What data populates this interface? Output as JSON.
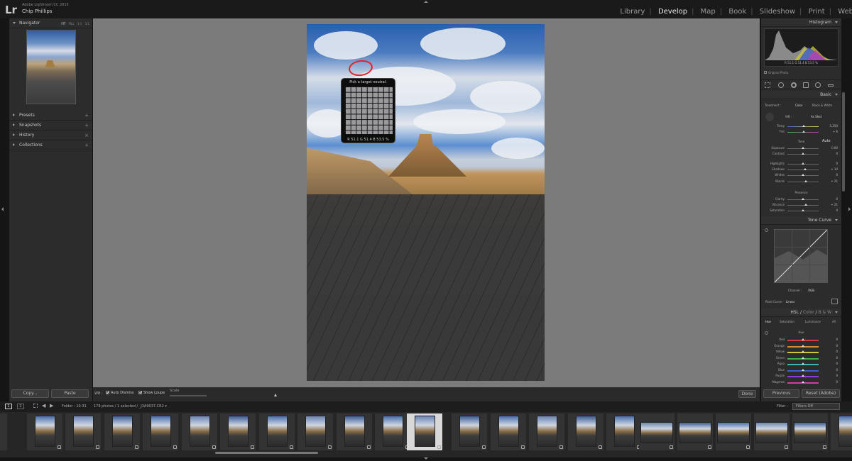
{
  "app": {
    "product": "Adobe Lightroom CC 2015",
    "user": "Chip Phillips",
    "logo": "Lr"
  },
  "modules": {
    "items": [
      "Library",
      "Develop",
      "Map",
      "Book",
      "Slideshow",
      "Print",
      "Web"
    ],
    "active": "Develop"
  },
  "left_panel": {
    "navigator": {
      "title": "Navigator",
      "options": [
        "FIT",
        "FILL",
        "1:1",
        "3:1"
      ]
    },
    "sections": [
      {
        "title": "Presets",
        "action": "+"
      },
      {
        "title": "Snapshots",
        "action": "+"
      },
      {
        "title": "History",
        "action": "×"
      },
      {
        "title": "Collections",
        "action": "+"
      }
    ],
    "copy_label": "Copy...",
    "paste_label": "Paste"
  },
  "loupe": {
    "title": "Pick a target neutral:",
    "readout": "R  51.1  G  51.4  B  53.5  %"
  },
  "toolbar": {
    "wb_label": "WB :",
    "auto_dismiss": "Auto Dismiss",
    "show_loupe": "Show Loupe",
    "scale_label": "Scale",
    "scale_level": 0.35,
    "done_label": "Done"
  },
  "right_panel": {
    "histogram": {
      "title": "Histogram",
      "readout": "R  51.1  G  51.4  B  53.5  %",
      "original_photo": "Original Photo"
    },
    "basic": {
      "title": "Basic",
      "treatment_label": "Treatment :",
      "treatment_color": "Color",
      "treatment_bw": "Black & White",
      "wb_label": "WB :",
      "wb_value": "As Shot",
      "temp": {
        "label": "Temp",
        "value": "5,350",
        "pos": 0.52
      },
      "tint": {
        "label": "Tint",
        "value": "+ 6",
        "pos": 0.53
      },
      "tone_label": "Tone",
      "auto_label": "Auto",
      "exposure": {
        "label": "Exposure",
        "value": "0.00",
        "pos": 0.5
      },
      "contrast": {
        "label": "Contrast",
        "value": "0",
        "pos": 0.5
      },
      "highlights": {
        "label": "Highlights",
        "value": "0",
        "pos": 0.5
      },
      "shadows": {
        "label": "Shadows",
        "value": "+ 14",
        "pos": 0.57
      },
      "whites": {
        "label": "Whites",
        "value": "0",
        "pos": 0.5
      },
      "blacks": {
        "label": "Blacks",
        "value": "+ 21",
        "pos": 0.6
      },
      "presence_label": "Presence",
      "clarity": {
        "label": "Clarity",
        "value": "0",
        "pos": 0.5
      },
      "vibrance": {
        "label": "Vibrance",
        "value": "+ 21",
        "pos": 0.6
      },
      "saturation": {
        "label": "Saturation",
        "value": "0",
        "pos": 0.5
      }
    },
    "tone_curve": {
      "title": "Tone Curve",
      "channel_label": "Channel :",
      "channel_value": "RGB",
      "point_curve_label": "Point Curve :",
      "point_curve_value": "Linear"
    },
    "hsl": {
      "title_hsl": "HSL",
      "title_color": "Color",
      "title_bw": "B & W",
      "tabs": [
        "Hue",
        "Saturation",
        "Luminance",
        "All"
      ],
      "group_label": "Hue",
      "rows": [
        {
          "label": "Red",
          "value": "0",
          "color": "#d23a3a"
        },
        {
          "label": "Orange",
          "value": "0",
          "color": "#d98a2e"
        },
        {
          "label": "Yellow",
          "value": "0",
          "color": "#cfc63a"
        },
        {
          "label": "Green",
          "value": "0",
          "color": "#3fb14a"
        },
        {
          "label": "Aqua",
          "value": "0",
          "color": "#3ab8b0"
        },
        {
          "label": "Blue",
          "value": "0",
          "color": "#3a5fd2"
        },
        {
          "label": "Purple",
          "value": "0",
          "color": "#8d3ad2"
        },
        {
          "label": "Magenta",
          "value": "0",
          "color": "#d23aa8"
        }
      ]
    },
    "previous_label": "Previous",
    "reset_label": "Reset (Adobe)"
  },
  "filmbar": {
    "page1": "1",
    "page2": "2",
    "folder": "Folder : 10-31",
    "counts": "179 photos / 1 selected / _J3A9037.CR2 ▾",
    "filter_label": "Filter :",
    "filter_value": "Filters Off"
  }
}
